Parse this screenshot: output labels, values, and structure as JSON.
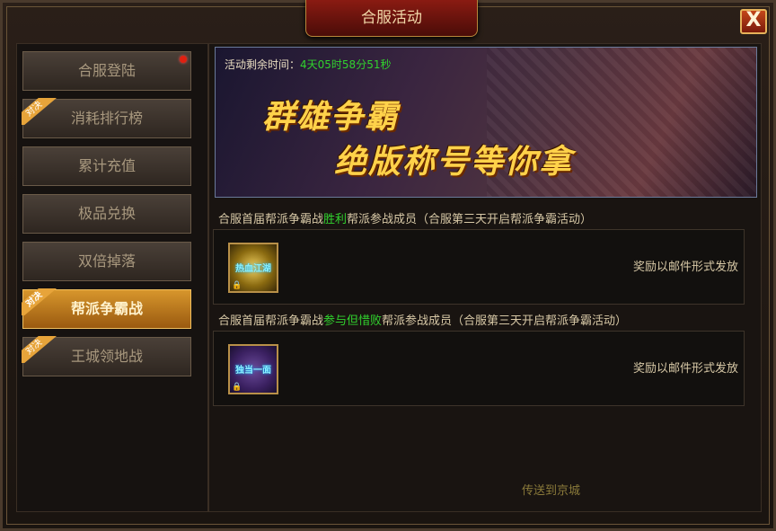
{
  "window": {
    "title": "合服活动",
    "close_label": "X"
  },
  "sidebar": {
    "items": [
      {
        "label": "合服登陆",
        "badge": "",
        "active": false,
        "red_dot": true
      },
      {
        "label": "消耗排行榜",
        "badge": "对决",
        "active": false,
        "red_dot": false
      },
      {
        "label": "累计充值",
        "badge": "",
        "active": false,
        "red_dot": false
      },
      {
        "label": "极品兑换",
        "badge": "",
        "active": false,
        "red_dot": false
      },
      {
        "label": "双倍掉落",
        "badge": "",
        "active": false,
        "red_dot": false
      },
      {
        "label": "帮派争霸战",
        "badge": "对决",
        "active": true,
        "red_dot": false
      },
      {
        "label": "王城领地战",
        "badge": "对决",
        "active": false,
        "red_dot": false
      }
    ]
  },
  "banner": {
    "timer_label": "活动剩余时间：",
    "timer_value": "4天05时58分51秒",
    "slogan_line1": "群雄争霸",
    "slogan_line2": "绝版称号等你拿"
  },
  "sections": [
    {
      "title_pre": "合服首届帮派争霸战",
      "title_highlight": "胜利",
      "title_post": "帮派参战成员（合服第三天开启帮派争霸活动）",
      "item_text": "热血江湖",
      "item_icon": "gold-title-icon",
      "note": "奖励以邮件形式发放"
    },
    {
      "title_pre": "合服首届帮派争霸战",
      "title_highlight": "参与但惜败",
      "title_post": "帮派参战成员（合服第三天开启帮派争霸活动）",
      "item_text": "独当一面",
      "item_icon": "purple-title-icon",
      "note": "奖励以邮件形式发放"
    }
  ],
  "footer": {
    "teleport_label": "传送到京城"
  },
  "colors": {
    "highlight_green": "#31d22e",
    "active_tab": "#d7962c",
    "title_red": "#8a1b12"
  }
}
